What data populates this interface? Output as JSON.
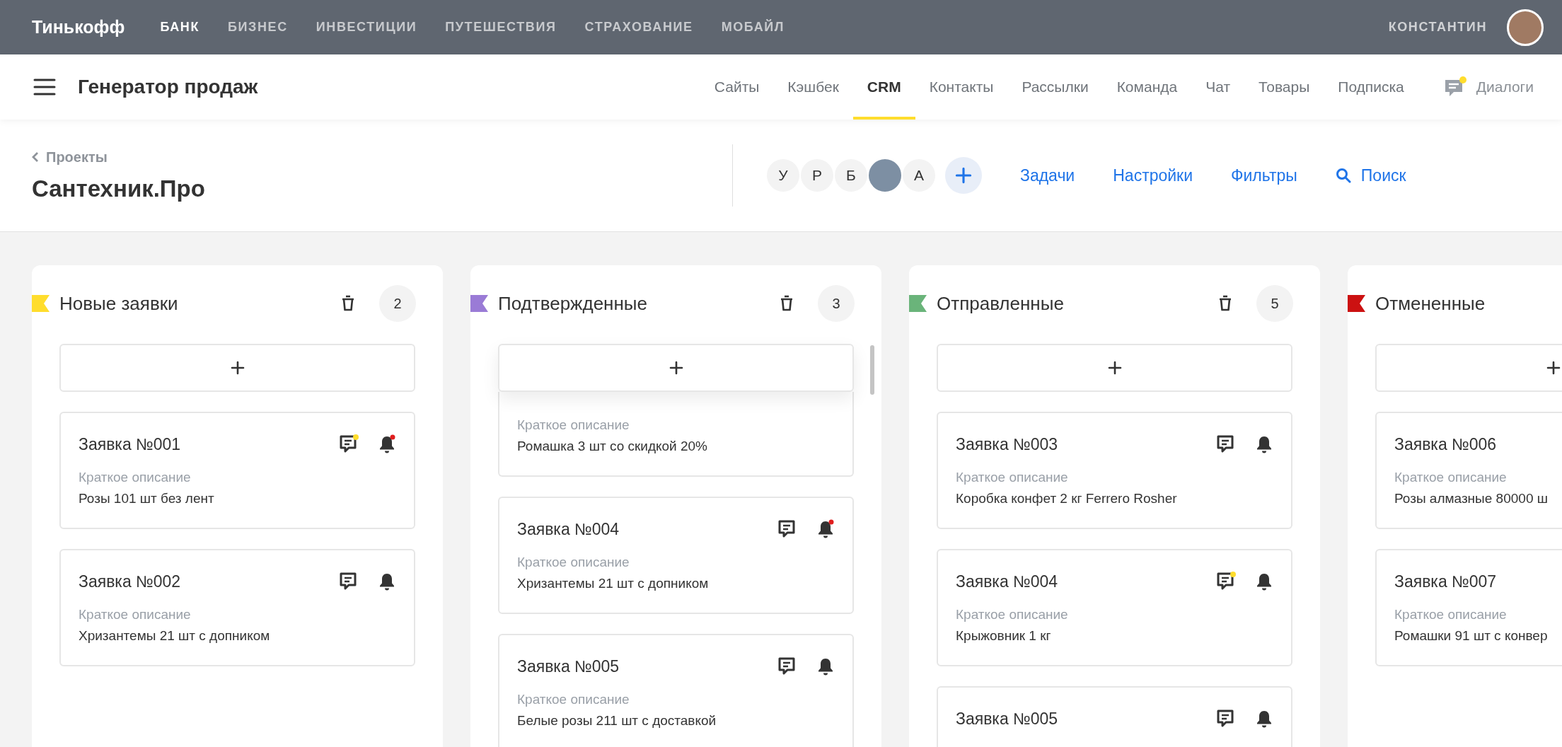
{
  "top_bar": {
    "logo": "Тинькофф",
    "items": [
      {
        "label": "БАНК",
        "selected": true
      },
      {
        "label": "БИЗНЕС",
        "selected": false
      },
      {
        "label": "ИНВЕСТИЦИИ",
        "selected": false
      },
      {
        "label": "ПУТЕШЕСТВИЯ",
        "selected": false
      },
      {
        "label": "СТРАХОВАНИЕ",
        "selected": false
      },
      {
        "label": "МОБАЙЛ",
        "selected": false
      }
    ],
    "user": "КОНСТАНТИН"
  },
  "app_bar": {
    "title": "Генератор продаж",
    "tabs": [
      {
        "label": "Сайты",
        "selected": false
      },
      {
        "label": "Кэшбек",
        "selected": false
      },
      {
        "label": "CRM",
        "selected": true
      },
      {
        "label": "Контакты",
        "selected": false
      },
      {
        "label": "Рассылки",
        "selected": false
      },
      {
        "label": "Команда",
        "selected": false
      },
      {
        "label": "Чат",
        "selected": false
      },
      {
        "label": "Товары",
        "selected": false
      },
      {
        "label": "Подписка",
        "selected": false
      }
    ],
    "dialogs": {
      "label": "Диалоги",
      "unread": true
    }
  },
  "project": {
    "breadcrumb": "Проекты",
    "title": "Сантехник.Про",
    "members": [
      {
        "kind": "letter",
        "label": "У"
      },
      {
        "kind": "letter",
        "label": "Р"
      },
      {
        "kind": "letter",
        "label": "Б"
      },
      {
        "kind": "photo"
      },
      {
        "kind": "letter",
        "label": "А"
      }
    ],
    "links": [
      {
        "kind": "link",
        "label": "Задачи"
      },
      {
        "kind": "link",
        "label": "Настройки"
      },
      {
        "kind": "link",
        "label": "Фильтры"
      },
      {
        "kind": "search",
        "label": "Поиск"
      }
    ]
  },
  "columns": [
    {
      "title": "Новые заявки",
      "color": "#ffdd2d",
      "count": "2",
      "scrollbar": false,
      "cards": [
        {
          "kind": "full",
          "title": "Заявка №001",
          "label": "Краткое описание",
          "text": "Розы 101 шт без лент",
          "comment_new": true,
          "bell_new": true
        },
        {
          "kind": "full",
          "title": "Заявка №002",
          "label": "Краткое описание",
          "text": "Хризантемы 21 шт с допником",
          "comment_new": false,
          "bell_new": false
        }
      ]
    },
    {
      "title": "Подтвержденные",
      "color": "#9a7bd6",
      "count": "3",
      "scrollbar": true,
      "cards": [
        {
          "kind": "clipped",
          "label": "Краткое описание",
          "text": "Ромашка 3 шт со скидкой 20%"
        },
        {
          "kind": "full",
          "title": "Заявка №004",
          "label": "Краткое описание",
          "text": "Хризантемы 21 шт с допником",
          "comment_new": false,
          "bell_new": true
        },
        {
          "kind": "full",
          "title": "Заявка №005",
          "label": "Краткое описание",
          "text": "Белые розы 211 шт с доставкой",
          "comment_new": false,
          "bell_new": false
        }
      ]
    },
    {
      "title": "Отправленные",
      "color": "#6ab47a",
      "count": "5",
      "scrollbar": false,
      "cards": [
        {
          "kind": "full",
          "title": "Заявка №003",
          "label": "Краткое описание",
          "text": "Коробка конфет 2 кг Ferrero Rosher",
          "comment_new": false,
          "bell_new": false
        },
        {
          "kind": "full",
          "title": "Заявка №004",
          "label": "Краткое описание",
          "text": "Крыжовник 1 кг",
          "comment_new": true,
          "bell_new": false
        },
        {
          "kind": "full",
          "title": "Заявка №005",
          "comment_new": false,
          "bell_new": false
        }
      ]
    },
    {
      "title": "Отмененные",
      "color": "#cc1111",
      "scrollbar": false,
      "cards": [
        {
          "kind": "full",
          "title": "Заявка №006",
          "label": "Краткое описание",
          "text": "Розы алмазные 80000 ш"
        },
        {
          "kind": "full",
          "title": "Заявка №007",
          "label": "Краткое описание",
          "text": "Ромашки 91 шт с конвер"
        }
      ]
    }
  ]
}
